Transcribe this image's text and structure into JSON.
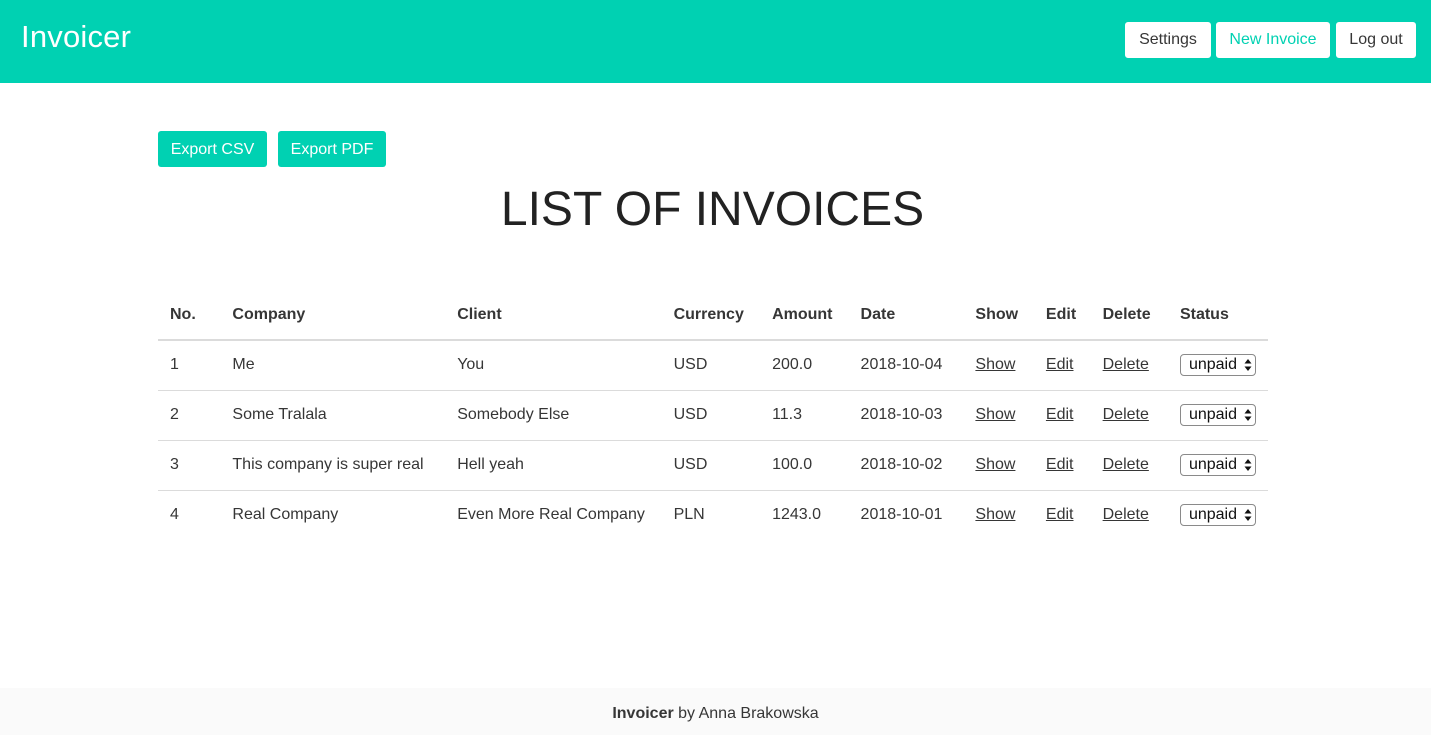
{
  "navbar": {
    "brand": "Invoicer",
    "settings_label": "Settings",
    "new_invoice_label": "New Invoice",
    "logout_label": "Log out"
  },
  "actions": {
    "export_csv_label": "Export CSV",
    "export_pdf_label": "Export PDF"
  },
  "page_title": "LIST OF INVOICES",
  "table": {
    "headers": {
      "no": "No.",
      "company": "Company",
      "client": "Client",
      "currency": "Currency",
      "amount": "Amount",
      "date": "Date",
      "show": "Show",
      "edit": "Edit",
      "delete": "Delete",
      "status": "Status"
    },
    "rows": [
      {
        "no": "1",
        "company": "Me",
        "client": "You",
        "currency": "USD",
        "amount": "200.0",
        "date": "2018-10-04",
        "show": "Show",
        "edit": "Edit",
        "delete": "Delete",
        "status": "unpaid"
      },
      {
        "no": "2",
        "company": "Some Tralala",
        "client": "Somebody Else",
        "currency": "USD",
        "amount": "11.3",
        "date": "2018-10-03",
        "show": "Show",
        "edit": "Edit",
        "delete": "Delete",
        "status": "unpaid"
      },
      {
        "no": "3",
        "company": "This company is super real",
        "client": "Hell yeah",
        "currency": "USD",
        "amount": "100.0",
        "date": "2018-10-02",
        "show": "Show",
        "edit": "Edit",
        "delete": "Delete",
        "status": "unpaid"
      },
      {
        "no": "4",
        "company": "Real Company",
        "client": "Even More Real Company",
        "currency": "PLN",
        "amount": "1243.0",
        "date": "2018-10-01",
        "show": "Show",
        "edit": "Edit",
        "delete": "Delete",
        "status": "unpaid"
      }
    ]
  },
  "footer": {
    "app_name": "Invoicer",
    "byline": " by Anna Brakowska"
  },
  "colors": {
    "accent": "#00d1b2",
    "text": "#363636",
    "footer_bg": "#fafafa"
  },
  "icons": {
    "status_select": "up-down-arrows-icon"
  }
}
